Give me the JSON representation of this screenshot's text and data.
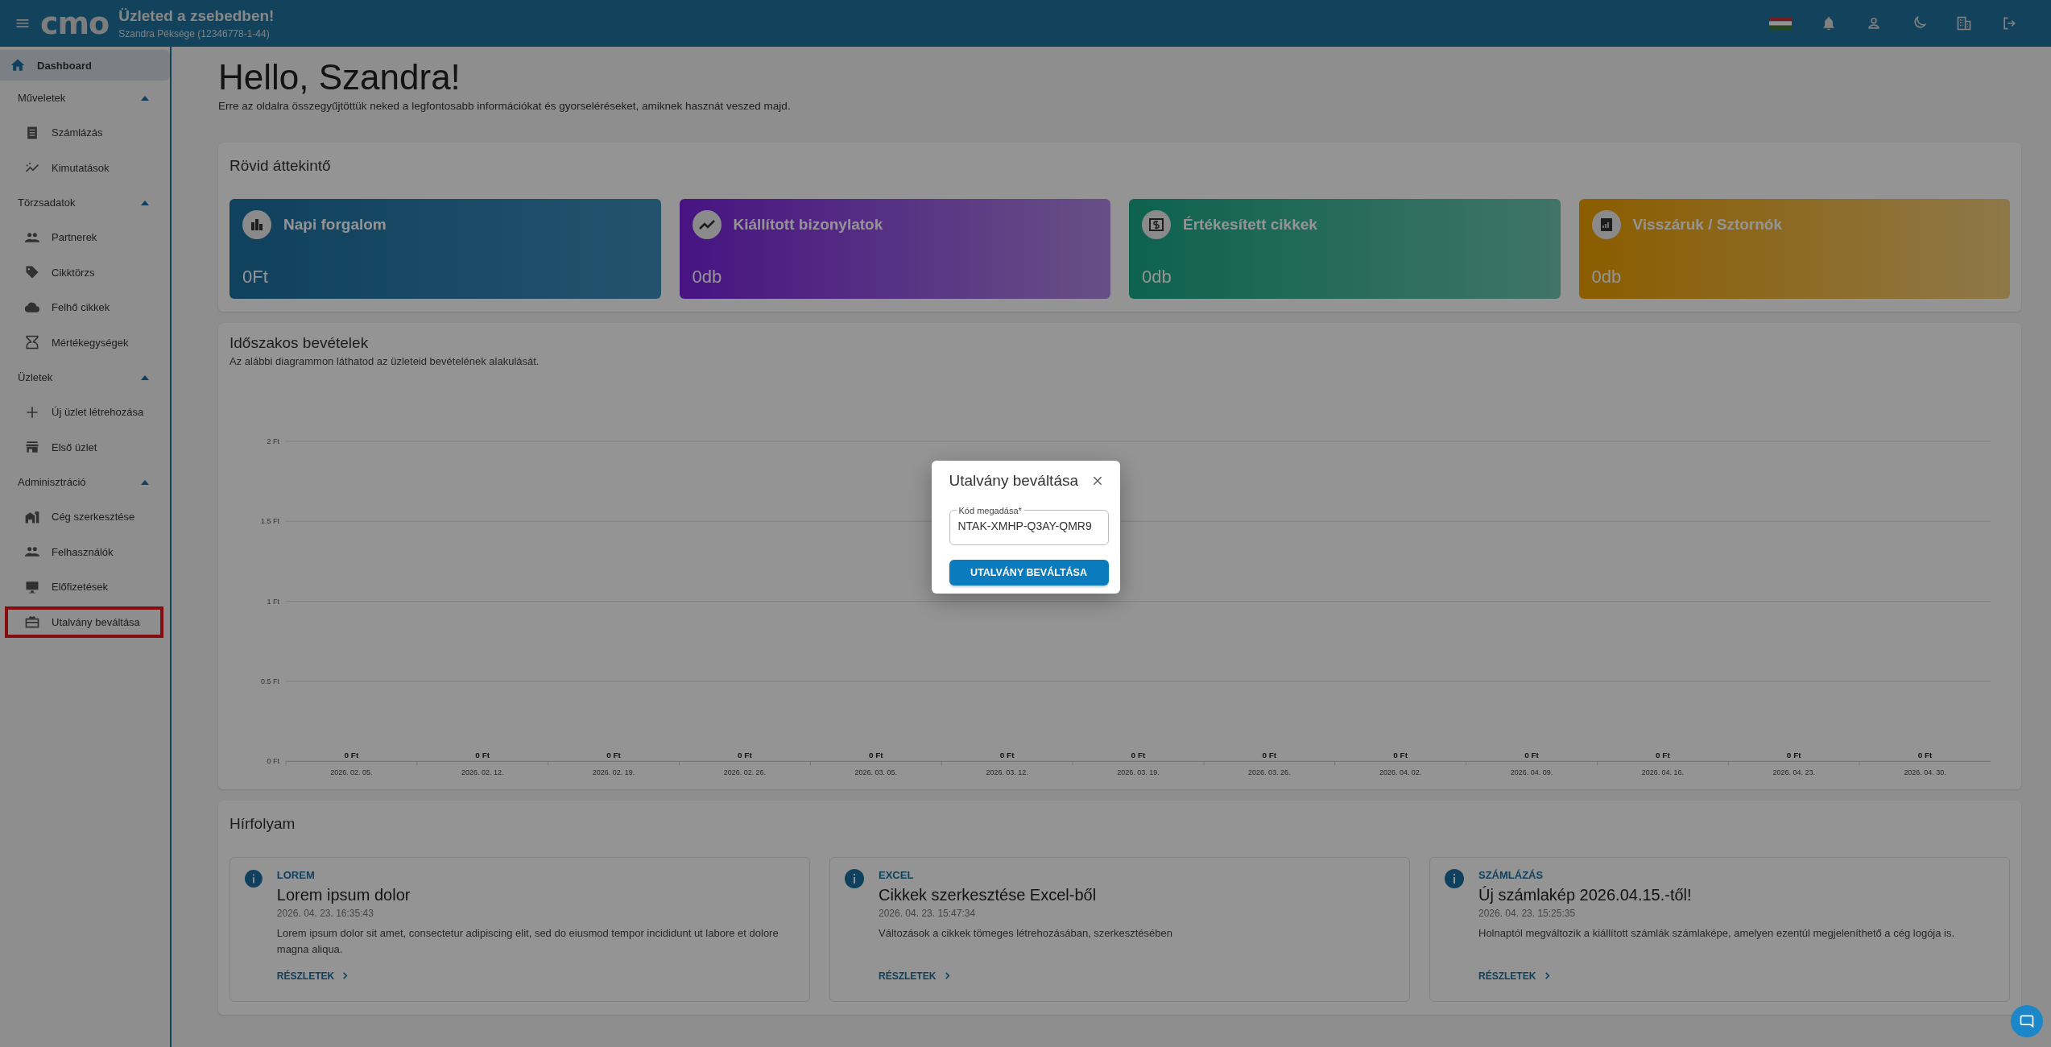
{
  "topbar": {
    "logo": "cmo",
    "title": "Üzleted a zsebedben!",
    "subtitle": "Szandra Péksége (12346778-1-44)"
  },
  "sidebar": {
    "home": {
      "label": "Dashboard",
      "selected": true
    },
    "sections": [
      {
        "title": "Műveletek",
        "expanded": true,
        "items": [
          {
            "label": "Számlázás",
            "selected": false,
            "highlighted": false
          },
          {
            "label": "Kimutatások",
            "selected": false,
            "highlighted": false
          }
        ]
      },
      {
        "title": "Törzsadatok",
        "expanded": true,
        "items": [
          {
            "label": "Partnerek",
            "selected": false,
            "highlighted": false
          },
          {
            "label": "Cikktörzs",
            "selected": false,
            "highlighted": false
          },
          {
            "label": "Felhő cikkek",
            "selected": false,
            "highlighted": false
          },
          {
            "label": "Mértékegységek",
            "selected": false,
            "highlighted": false
          }
        ]
      },
      {
        "title": "Üzletek",
        "expanded": true,
        "items": [
          {
            "label": "Új üzlet létrehozása",
            "selected": false,
            "highlighted": false
          },
          {
            "label": "Első üzlet",
            "selected": false,
            "highlighted": false
          }
        ]
      },
      {
        "title": "Adminisztráció",
        "expanded": true,
        "items": [
          {
            "label": "Cég szerkesztése",
            "selected": false,
            "highlighted": false
          },
          {
            "label": "Felhasználók",
            "selected": false,
            "highlighted": false
          },
          {
            "label": "Előfizetések",
            "selected": false,
            "highlighted": false
          },
          {
            "label": "Utalvány beváltása",
            "selected": false,
            "highlighted": true
          }
        ]
      }
    ]
  },
  "greeting": {
    "title": "Hello, Szandra!",
    "subtitle": "Erre az oldalra összegyűjtöttük neked a legfontosabb információkat és gyorseléréseket, amiknek hasznát veszed majd."
  },
  "overview": {
    "title": "Rövid áttekintő",
    "cards": [
      {
        "label": "Napi forgalom",
        "value": "0Ft"
      },
      {
        "label": "Kiállított bizonylatok",
        "value": "0db"
      },
      {
        "label": "Értékesített cikkek",
        "value": "0db"
      },
      {
        "label": "Visszáruk / Sztornók",
        "value": "0db"
      }
    ]
  },
  "revenue": {
    "title": "Időszakos bevételek",
    "subtitle": "Az alábbi diagrammon láthatod az üzleteid bevételének alakulását.",
    "chart_data": {
      "type": "bar",
      "categories": [
        "2026. 02. 05.",
        "2026. 02. 12.",
        "2026. 02. 19.",
        "2026. 02. 26.",
        "2026. 03. 05.",
        "2026. 03. 12.",
        "2026. 03. 19.",
        "2026. 03. 26.",
        "2026. 04. 02.",
        "2026. 04. 09.",
        "2026. 04. 16.",
        "2026. 04. 23.",
        "2026. 04. 30."
      ],
      "values": [
        0,
        0,
        0,
        0,
        0,
        0,
        0,
        0,
        0,
        0,
        0,
        0,
        0
      ],
      "value_labels": [
        "0 Ft",
        "0 Ft",
        "0 Ft",
        "0 Ft",
        "0 Ft",
        "0 Ft",
        "0 Ft",
        "0 Ft",
        "0 Ft",
        "0 Ft",
        "0 Ft",
        "0 Ft",
        "0 Ft"
      ],
      "ylim": [
        0,
        2
      ],
      "grid": true,
      "yticks": [
        {
          "value": 0,
          "label": "0 Ft"
        },
        {
          "value": 0.5,
          "label": "0.5 Ft"
        },
        {
          "value": 1,
          "label": "1 Ft"
        },
        {
          "value": 1.5,
          "label": "1.5 Ft"
        },
        {
          "value": 2,
          "label": "2 Ft"
        }
      ]
    }
  },
  "news": {
    "title": "Hírfolyam",
    "items": [
      {
        "tag": "LOREM",
        "title": "Lorem ipsum dolor",
        "date": "2026. 04. 23. 16:35:43",
        "text": "Lorem ipsum dolor sit amet, consectetur adipiscing elit, sed do eiusmod tempor incididunt ut labore et dolore magna aliqua.",
        "link": "RÉSZLETEK"
      },
      {
        "tag": "EXCEL",
        "title": "Cikkek szerkesztése Excel-ből",
        "date": "2026. 04. 23. 15:47:34",
        "text": "Változások a cikkek tömeges létrehozásában, szerkesztésében",
        "link": "RÉSZLETEK"
      },
      {
        "tag": "SZÁMLÁZÁS",
        "title": "Új számlakép 2026.04.15.-től!",
        "date": "2026. 04. 23. 15:25:35",
        "text": "Holnaptól megváltozik a kiállított számlák számlaképe, amelyen ezentúl megjeleníthető a cég logója is.",
        "link": "RÉSZLETEK"
      }
    ]
  },
  "dialog": {
    "title": "Utalvány beváltása",
    "field": {
      "label": "Kód megadása*",
      "value": "NTAK-XMHP-Q3AY-QMR9"
    },
    "button": "UTALVÁNY BEVÁLTÁSA"
  }
}
